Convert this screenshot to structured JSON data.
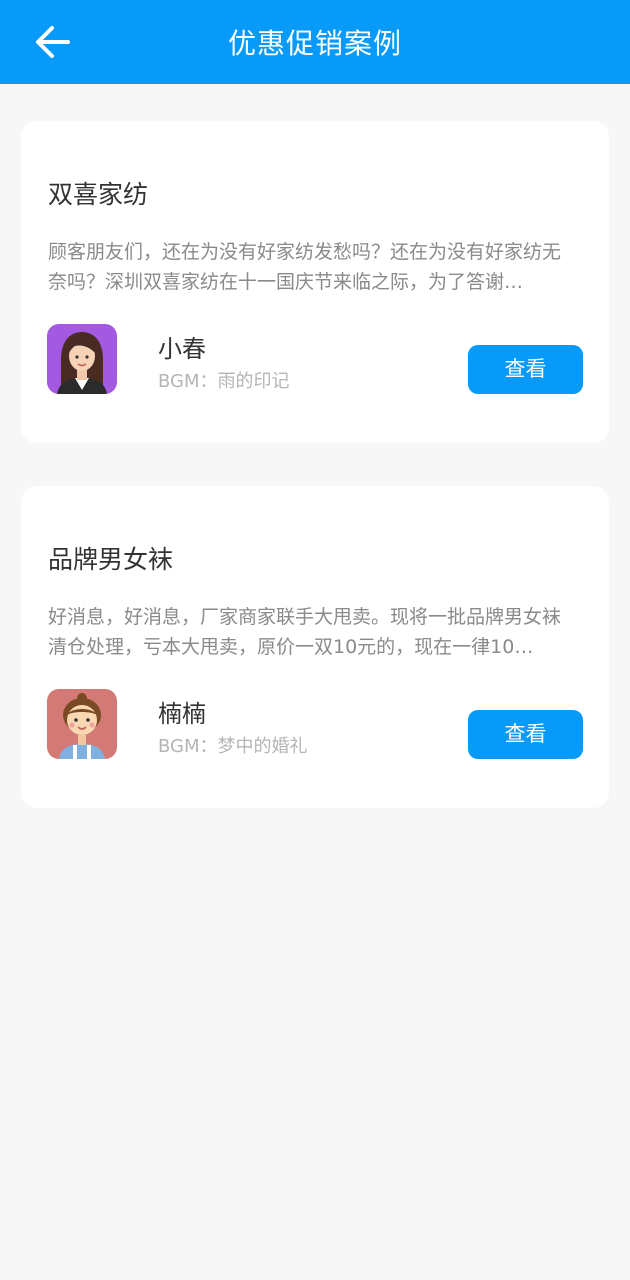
{
  "header": {
    "title": "优惠促销案例",
    "back_icon": "arrow-left-icon"
  },
  "colors": {
    "accent": "#079af9",
    "background": "#f7f7f7",
    "card": "#ffffff",
    "title_text": "#333333",
    "desc_text": "#8a8a8a",
    "muted_text": "#b5b5b5"
  },
  "cases": [
    {
      "title": "双喜家纺",
      "description": "顾客朋友们，还在为没有好家纺发愁吗？还在为没有好家纺无奈吗？深圳双喜家纺在十一国庆节来临之际，为了答谢…",
      "author": "小春",
      "bgm": "BGM：雨的印记",
      "avatar_icon": "woman-avatar-icon",
      "button_label": "查看"
    },
    {
      "title": "品牌男女袜",
      "description": "好消息，好消息，厂家商家联手大甩卖。现将一批品牌男女袜清仓处理，亏本大甩卖，原价一双10元的，现在一律10…",
      "author": "楠楠",
      "bgm": "BGM：梦中的婚礼",
      "avatar_icon": "girl-avatar-icon",
      "button_label": "查看"
    }
  ]
}
